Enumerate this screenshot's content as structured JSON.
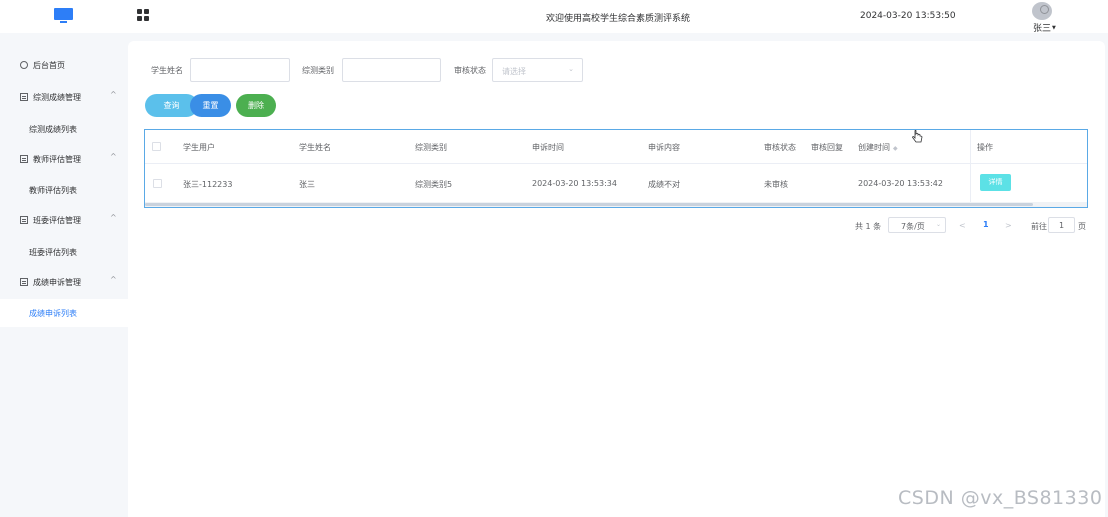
{
  "header": {
    "welcome": "欢迎使用高校学生综合素质测评系统",
    "datetime": "2024-03-20 13:53:50",
    "username": "张三"
  },
  "sidebar": {
    "items": [
      {
        "label": "后台首页",
        "icon": "clock-icon"
      },
      {
        "label": "综测成绩管理",
        "icon": "doc-icon",
        "sub": "综测成绩列表"
      },
      {
        "label": "教师评估管理",
        "icon": "doc-icon",
        "sub": "教师评估列表"
      },
      {
        "label": "班委评估管理",
        "icon": "doc-icon",
        "sub": "班委评估列表"
      },
      {
        "label": "成绩申诉管理",
        "icon": "doc-icon",
        "sub": "成绩申诉列表"
      }
    ]
  },
  "search": {
    "student_name_label": "学生姓名",
    "category_label": "综测类别",
    "status_label": "审核状态",
    "status_placeholder": "请选择"
  },
  "actions": {
    "query": "查询",
    "reset": "重置",
    "delete": "删除"
  },
  "table": {
    "headers": [
      "学生用户",
      "学生姓名",
      "综测类别",
      "申诉时间",
      "申诉内容",
      "审核状态",
      "审核回复",
      "创建时间",
      "操作"
    ],
    "rows": [
      {
        "user": "张三-112233",
        "name": "张三",
        "category": "综测类别5",
        "appeal_time": "2024-03-20 13:53:34",
        "content": "成绩不对",
        "status": "未审核",
        "reply": "",
        "created": "2024-03-20 13:53:42",
        "action": "详情"
      }
    ]
  },
  "pagination": {
    "total": "共 1 条",
    "page_size": "7条/页",
    "current": "1",
    "goto_label": "前往",
    "goto_value": "1",
    "page_suffix": "页"
  },
  "watermark": "CSDN @vx_BS81330",
  "colors": {
    "accent": "#2d7ef7",
    "query": "#5bc0eb",
    "reset": "#3a8ee6",
    "delete": "#4caf50",
    "detail": "#5ce1e6"
  }
}
